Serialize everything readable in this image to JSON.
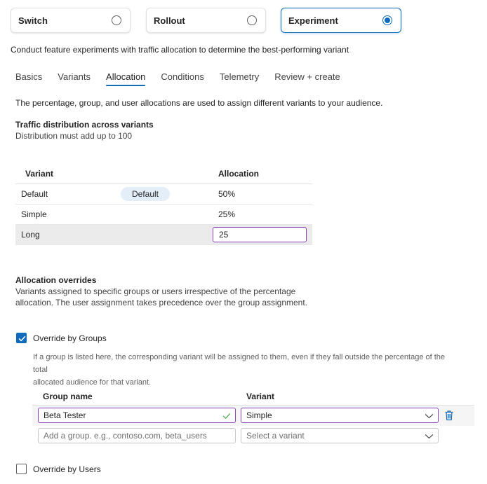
{
  "type_cards": [
    {
      "label": "Switch",
      "selected": false
    },
    {
      "label": "Rollout",
      "selected": false
    },
    {
      "label": "Experiment",
      "selected": true
    }
  ],
  "description": "Conduct feature experiments with traffic allocation to determine the best-performing variant",
  "tabs": [
    "Basics",
    "Variants",
    "Allocation",
    "Conditions",
    "Telemetry",
    "Review + create"
  ],
  "active_tab": "Allocation",
  "intro": "The percentage, group, and user allocations are used to assign different variants to your audience.",
  "traffic": {
    "title": "Traffic distribution across variants",
    "subtitle": "Distribution must add up to 100",
    "columns": {
      "variant": "Variant",
      "allocation": "Allocation"
    },
    "rows": [
      {
        "variant": "Default",
        "badge": "Default",
        "allocation": "50%"
      },
      {
        "variant": "Simple",
        "badge": "",
        "allocation": "25%"
      },
      {
        "variant": "Long",
        "badge": "",
        "allocation": "25"
      }
    ]
  },
  "overrides": {
    "title": "Allocation overrides",
    "subtitle_line1": "Variants assigned to specific groups or users irrespective of the percentage",
    "subtitle_line2": "allocation. The user assignment takes precedence over the group assignment."
  },
  "override_groups": {
    "label": "Override by Groups",
    "checked": true,
    "hint_line1": "If a group is listed here, the corresponding variant will be assigned to them, even if they fall outside the percentage of the total",
    "hint_line2": "allocated audience for that variant.",
    "columns": {
      "group": "Group name",
      "variant": "Variant"
    },
    "rows": [
      {
        "group": "Beta Tester",
        "variant": "Simple"
      }
    ],
    "new_row": {
      "group_placeholder": "Add a group. e.g., contoso.com, beta_users",
      "variant_placeholder": "Select a variant"
    }
  },
  "override_users": {
    "label": "Override by Users",
    "checked": false
  },
  "colors": {
    "accent": "#0f6cbd",
    "focus_border": "#8a3fbd",
    "badge_bg": "#e3eef9",
    "selected_row_bg": "#ebebeb"
  },
  "icons": [
    "radio-icon",
    "checkbox-check-icon",
    "chevron-down-icon",
    "checkmark-icon",
    "delete-icon"
  ]
}
